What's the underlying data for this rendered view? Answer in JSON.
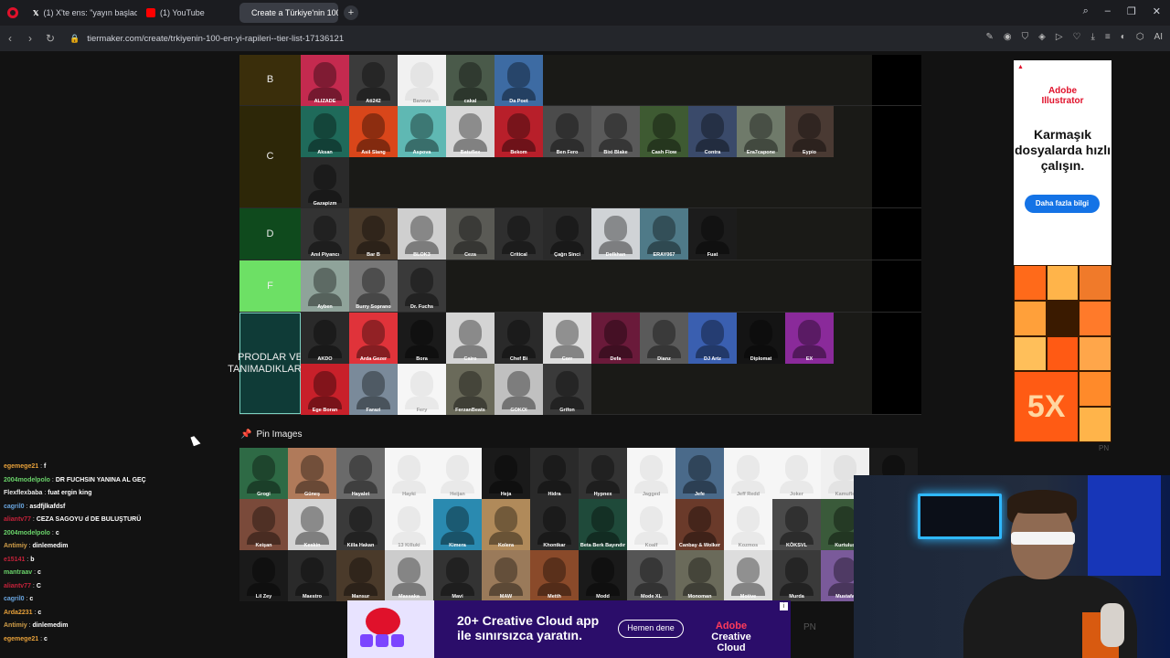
{
  "browser": {
    "tabs": [
      {
        "label": "(1) X'te ens: \"yayın başlad...",
        "icon": "x-icon"
      },
      {
        "label": "(1) YouTube",
        "icon": "youtube-icon"
      },
      {
        "label": "Create a Türkiye'nin 100 - ...",
        "icon": "tiermaker-icon",
        "active": true
      }
    ],
    "url": "tiermaker.com/create/trkiyenin-100-en-yi-rapileri--tier-list-17136121",
    "ai_label": "AI"
  },
  "tiers": [
    {
      "label": "B",
      "color": "#3a2e0b",
      "items": [
        {
          "name": "ALIZADE",
          "bg": "#c42a4f"
        },
        {
          "name": "Ati242",
          "bg": "#3b3b3b"
        },
        {
          "name": "Baneva",
          "bg": "#f1f1f1",
          "light": true
        },
        {
          "name": "cakal",
          "bg": "#4a5a4a"
        },
        {
          "name": "Da Poet",
          "bg": "#3d6ba3"
        }
      ]
    },
    {
      "label": "C",
      "color": "#2d2708",
      "items": [
        {
          "name": "Aksan",
          "bg": "#1f6a5a"
        },
        {
          "name": "Asil Slang",
          "bg": "#d9461a"
        },
        {
          "name": "Aspova",
          "bg": "#5fb8b3"
        },
        {
          "name": "Batuflex",
          "bg": "#d8d8d8"
        },
        {
          "name": "Bekom",
          "bg": "#b81f2a"
        },
        {
          "name": "Ben Fero",
          "bg": "#4b4b4b"
        },
        {
          "name": "Bixi Blake",
          "bg": "#5a5a5a"
        },
        {
          "name": "Cash Flow",
          "bg": "#3e5a32"
        },
        {
          "name": "Contra",
          "bg": "#3a4a6a"
        },
        {
          "name": "Era7capone",
          "bg": "#6f7a6a"
        },
        {
          "name": "Eypio",
          "bg": "#4a3a33"
        },
        {
          "name": "Gazapizm",
          "bg": "#2a2a2a"
        }
      ]
    },
    {
      "label": "D",
      "color": "#0f4a1d",
      "items": [
        {
          "name": "Anıl Piyancı",
          "bg": "#333"
        },
        {
          "name": "Bar B",
          "bg": "#4a3a2a"
        },
        {
          "name": "BLOK3",
          "bg": "#cfcfcf"
        },
        {
          "name": "Ceza",
          "bg": "#5a5a55"
        },
        {
          "name": "Critical",
          "bg": "#2f2f2f"
        },
        {
          "name": "Çağrı Sinci",
          "bg": "#2a2a2a"
        },
        {
          "name": "Defkhan",
          "bg": "#d0d3d6"
        },
        {
          "name": "ERAY067",
          "bg": "#4f7a88"
        },
        {
          "name": "Fuat",
          "bg": "#1c1c1c"
        }
      ]
    },
    {
      "label": "F",
      "color": "#6de065",
      "items": [
        {
          "name": "Ayben",
          "bg": "#8fa39a"
        },
        {
          "name": "Burry Soprano",
          "bg": "#777"
        },
        {
          "name": "Dr. Fuchs",
          "bg": "#3a3a3a"
        }
      ]
    },
    {
      "label": "PRODLAR VE TANIMADIKLARIM",
      "color": "#0f3b37",
      "items": [
        {
          "name": "AKDO",
          "bg": "#2a2a2a"
        },
        {
          "name": "Arda Gezer",
          "bg": "#e0333a"
        },
        {
          "name": "Bora",
          "bg": "#1a1a1a"
        },
        {
          "name": "Cairo",
          "bg": "#d4d4d4"
        },
        {
          "name": "Chef Bi",
          "bg": "#2a2a2a"
        },
        {
          "name": "Corr",
          "bg": "#ddd"
        },
        {
          "name": "Defa",
          "bg": "#6a1a3a"
        },
        {
          "name": "Dianz",
          "bg": "#5a5a5a"
        },
        {
          "name": "DJ Artz",
          "bg": "#3a5fb0"
        },
        {
          "name": "Diplomat",
          "bg": "#141414"
        },
        {
          "name": "EX",
          "bg": "#8a2a9a"
        },
        {
          "name": "Ege Boran",
          "bg": "#c8202a"
        },
        {
          "name": "Farazi",
          "bg": "#7a8a9a"
        },
        {
          "name": "Fery",
          "bg": "#f6f6f6",
          "light": true
        },
        {
          "name": "FerzanBeats",
          "bg": "#6a6a5a"
        },
        {
          "name": "GOKOI",
          "bg": "#c0c0c0"
        },
        {
          "name": "Grifon",
          "bg": "#3a3a3a"
        }
      ]
    }
  ],
  "pin_images": {
    "title": "Pin Images",
    "items": [
      {
        "name": "Grogi",
        "bg": "#2e6a45"
      },
      {
        "name": "Güneş",
        "bg": "#b07a5a"
      },
      {
        "name": "Hayalet",
        "bg": "#6a6a6a"
      },
      {
        "name": "Hayki",
        "bg": "#f6f6f6",
        "light": true
      },
      {
        "name": "Heijan",
        "bg": "#f6f6f6",
        "light": true
      },
      {
        "name": "Heja",
        "bg": "#1a1a1a"
      },
      {
        "name": "Hidra",
        "bg": "#2a2a2a"
      },
      {
        "name": "Hypnex",
        "bg": "#333"
      },
      {
        "name": "Jagged",
        "bg": "#f6f6f6",
        "light": true
      },
      {
        "name": "Jefe",
        "bg": "#4a6a8a"
      },
      {
        "name": "Jeff Redd",
        "bg": "#f6f6f6",
        "light": true
      },
      {
        "name": "Joker",
        "bg": "#f6f6f6",
        "light": true
      },
      {
        "name": "Kamufle",
        "bg": "#f0f0f0",
        "light": true
      },
      {
        "name": "",
        "bg": "#1a1a1a"
      },
      {
        "name": "Keişan",
        "bg": "#7a4a3a"
      },
      {
        "name": "Keskin",
        "bg": "#d4d4d4"
      },
      {
        "name": "Killa Hakan",
        "bg": "#3a3a3a"
      },
      {
        "name": "13 Killuki",
        "bg": "#f6f6f6",
        "light": true
      },
      {
        "name": "Kimera",
        "bg": "#2a8ab0"
      },
      {
        "name": "Kolera",
        "bg": "#b08a5a"
      },
      {
        "name": "Khontkar",
        "bg": "#2a2a2a"
      },
      {
        "name": "Beta Berk Bayındır",
        "bg": "#1f4a3a"
      },
      {
        "name": "Koalf",
        "bg": "#f6f6f6",
        "light": true
      },
      {
        "name": "Canbay & Wolker",
        "bg": "#6a3a2a"
      },
      {
        "name": "Kozmos",
        "bg": "#f6f6f6",
        "light": true
      },
      {
        "name": "KÖKSVL",
        "bg": "#4a4a4a"
      },
      {
        "name": "Kurtuluş",
        "bg": "#3a5a3a"
      },
      {
        "name": "",
        "bg": "#121212"
      },
      {
        "name": "Lil Zey",
        "bg": "#1a1a1a"
      },
      {
        "name": "Maestro",
        "bg": "#2a2a2a"
      },
      {
        "name": "Mansur",
        "bg": "#4a3a2a"
      },
      {
        "name": "Massaka",
        "bg": "#ccc"
      },
      {
        "name": "Mavi",
        "bg": "#333"
      },
      {
        "name": "MAW",
        "bg": "#9a7a5a"
      },
      {
        "name": "Metth",
        "bg": "#8a4a2a"
      },
      {
        "name": "Modd",
        "bg": "#1a1a1a"
      },
      {
        "name": "Mode XL",
        "bg": "#555"
      },
      {
        "name": "Monoman",
        "bg": "#6a6a5a"
      },
      {
        "name": "Motive",
        "bg": "#ddd"
      },
      {
        "name": "Murda",
        "bg": "#3a3a3a"
      },
      {
        "name": "Mustafa",
        "bg": "#7a5a9a"
      }
    ]
  },
  "chat": [
    {
      "user": "egemege21",
      "color": "#e8a13a",
      "msg": "f"
    },
    {
      "user": "2004modelpolo",
      "color": "#6ad36a",
      "msg": "DR FUCHSIN YANINA AL GEÇ"
    },
    {
      "user": "Flexflexbaba",
      "color": "#eaeaea",
      "msg": "fuat ergin king"
    },
    {
      "user": "cagril0",
      "color": "#6aa6e0",
      "msg": "asdfjlkafdsf"
    },
    {
      "user": "aliantv77",
      "color": "#c4223a",
      "msg": "CEZA SAGOYU d DE BULUŞTURÜ"
    },
    {
      "user": "2004modelpolo",
      "color": "#6ad36a",
      "msg": "c"
    },
    {
      "user": "Antimiy",
      "color": "#d3a04a",
      "msg": "dinlemedim"
    },
    {
      "user": "e15141",
      "color": "#c4223a",
      "msg": "b"
    },
    {
      "user": "mantraav",
      "color": "#6ad36a",
      "msg": "c"
    },
    {
      "user": "aliantv77",
      "color": "#c4223a",
      "msg": "C"
    },
    {
      "user": "cagril0",
      "color": "#6aa6e0",
      "msg": "c"
    },
    {
      "user": "Arda2231",
      "color": "#e8a13a",
      "msg": "c"
    },
    {
      "user": "Antimiy",
      "color": "#d3a04a",
      "msg": "dinlemedim"
    },
    {
      "user": "egemege21",
      "color": "#e8a13a",
      "msg": "c"
    }
  ],
  "ad_side": {
    "brand_line1": "Adobe",
    "brand_line2": "Illustrator",
    "slogan": "Karmaşık dosyalarda hızlı çalışın.",
    "cta": "Daha fazla bilgi",
    "big_text": "5X",
    "pn": "PN"
  },
  "ad_bottom": {
    "headline_line1": "20+ Creative Cloud app",
    "headline_line2": "ile sınırsızca yaratın.",
    "cta": "Hemen dene",
    "brand_line1": "Adobe",
    "brand_line2": "Creative Cloud",
    "pn": "PN"
  }
}
